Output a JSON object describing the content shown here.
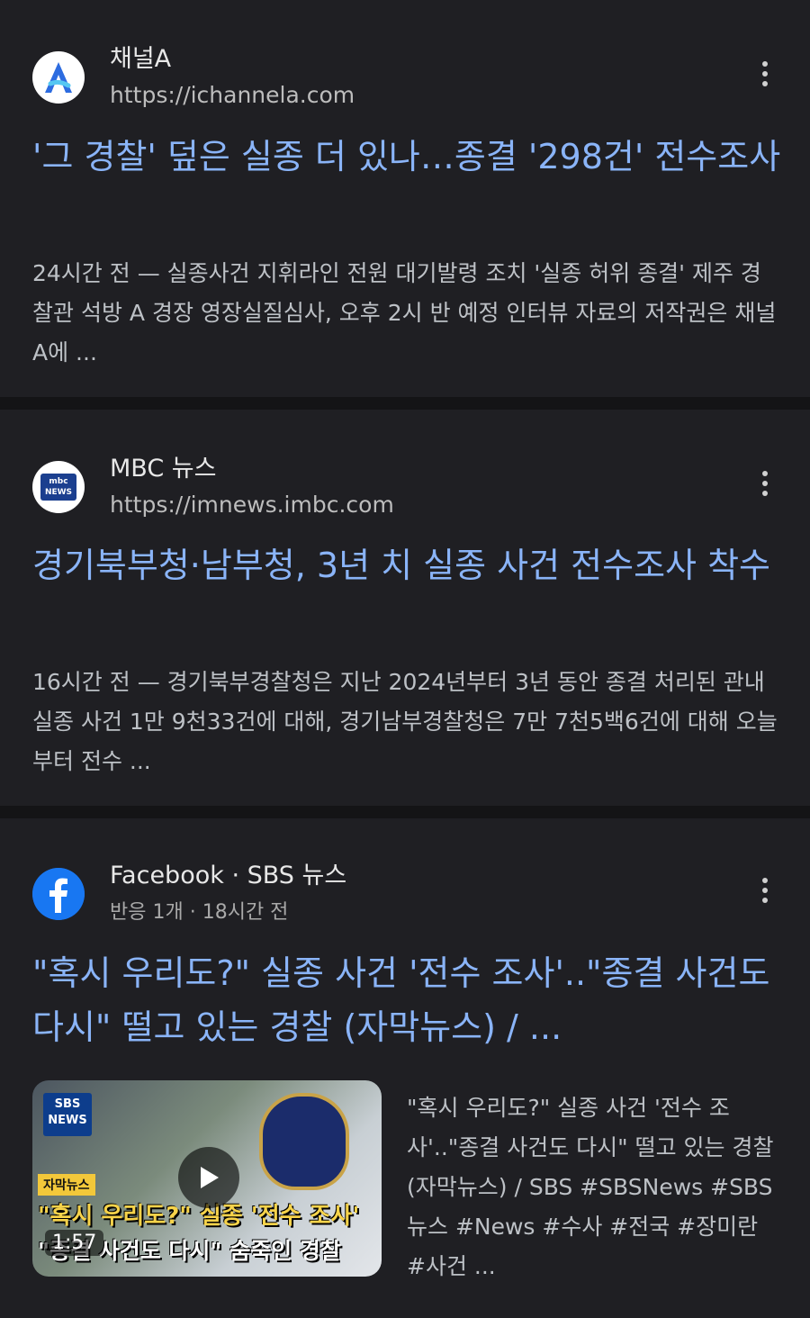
{
  "results": [
    {
      "source_name": "채널A",
      "source_url": "https://ichannela.com",
      "favicon": "channela-logo-icon",
      "title": "'그 경찰' 덮은 실종 더 있나…종결 '298건' 전수조사",
      "snippet": "24시간 전 — 실종사건 지휘라인 전원 대기발령 조치 '실종 허위 종결' 제주 경찰관 석방 A 경장 영장실질심사, 오후 2시 반 예정 인터뷰 자료의 저작권은 채널A에 ..."
    },
    {
      "source_name": "MBC 뉴스",
      "source_url": "https://imnews.imbc.com",
      "favicon": "mbc-news-logo-icon",
      "favicon_text": "mbc NEWS",
      "title": "경기북부청·남부청, 3년 치 실종 사건 전수조사 착수",
      "snippet": "16시간 전 — 경기북부경찰청은 지난 2024년부터 3년 동안 종결 처리된 관내 실종 사건 1만 9천33건에 대해, 경기남부경찰청은 7만 7천5백6건에 대해 오늘부터 전수 ..."
    },
    {
      "source_name": "Facebook · SBS 뉴스",
      "source_meta_reactions": "반응 1개",
      "source_meta_time": "18시간 전",
      "favicon": "facebook-logo-icon",
      "title": "\"혹시 우리도?\" 실종 사건 '전수 조사'..\"종결 사건도 다시\" 떨고 있는 경찰 (자막뉴스) / ...",
      "video": {
        "duration": "1:57",
        "logo_text": "SBS NEWS",
        "tag": "자막뉴스",
        "caption_line1": "\"혹시 우리도?\" 실종 '전수 조사'",
        "caption_line2": "\"종결 사건도 다시\" 숨죽인 경찰"
      },
      "snippet": "\"혹시 우리도?\" 실종 사건 '전수 조사'..\"종결 사건도 다시\" 떨고 있는 경찰 (자막뉴스) / SBS #SBSNews #SBS뉴스 #News #수사 #전국 #장미란 #사건 ..."
    }
  ],
  "colors": {
    "background": "#1f1f23",
    "separator": "#141416",
    "title_link": "#8ab4f8",
    "snippet": "#bdc1c6"
  }
}
